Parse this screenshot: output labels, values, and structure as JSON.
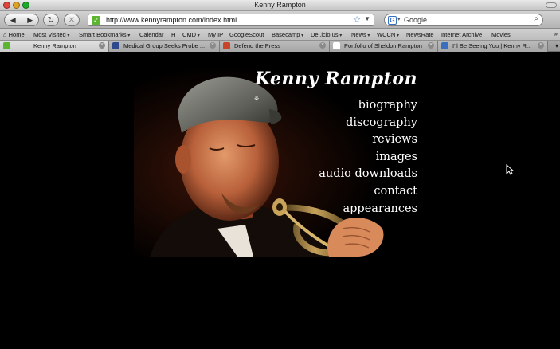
{
  "window": {
    "title": "Kenny Rampton"
  },
  "toolbar": {
    "back_icon": "back-arrow",
    "forward_icon": "forward-arrow",
    "reload_icon": "reload",
    "stop_icon": "stop-x",
    "url": "http://www.kennyrampton.com/index.html",
    "search_placeholder": "Google"
  },
  "bookmarks": [
    {
      "label": "Home",
      "dropdown": false
    },
    {
      "label": "Most Visited",
      "dropdown": true
    },
    {
      "label": "Smart Bookmarks",
      "dropdown": true
    },
    {
      "label": "Calendar",
      "dropdown": false
    },
    {
      "label": "H",
      "dropdown": false
    },
    {
      "label": "CMD",
      "dropdown": true
    },
    {
      "label": "My IP",
      "dropdown": false
    },
    {
      "label": "GoogleScout",
      "dropdown": false
    },
    {
      "label": "Basecamp",
      "dropdown": true
    },
    {
      "label": "Del.icio.us",
      "dropdown": true
    },
    {
      "label": "News",
      "dropdown": true
    },
    {
      "label": "WCCN",
      "dropdown": true
    },
    {
      "label": "NewsRate",
      "dropdown": false
    },
    {
      "label": "Internet Archive",
      "dropdown": false
    },
    {
      "label": "Movies",
      "dropdown": false
    }
  ],
  "tabs": [
    {
      "label": "Kenny Rampton",
      "active": true
    },
    {
      "label": "Medical Group Seeks Probe ...",
      "active": false
    },
    {
      "label": "Defend the Press",
      "active": false
    },
    {
      "label": "Portfolio of Sheldon Rampton",
      "active": false
    },
    {
      "label": "I'll Be Seeing You | Kenny R...",
      "active": false
    }
  ],
  "page": {
    "site_name": "Kenny Rampton",
    "menu": [
      "biography",
      "discography",
      "reviews",
      "images",
      "audio downloads",
      "contact",
      "appearances"
    ]
  },
  "colors": {
    "background": "#000000",
    "text": "#ffffff"
  }
}
